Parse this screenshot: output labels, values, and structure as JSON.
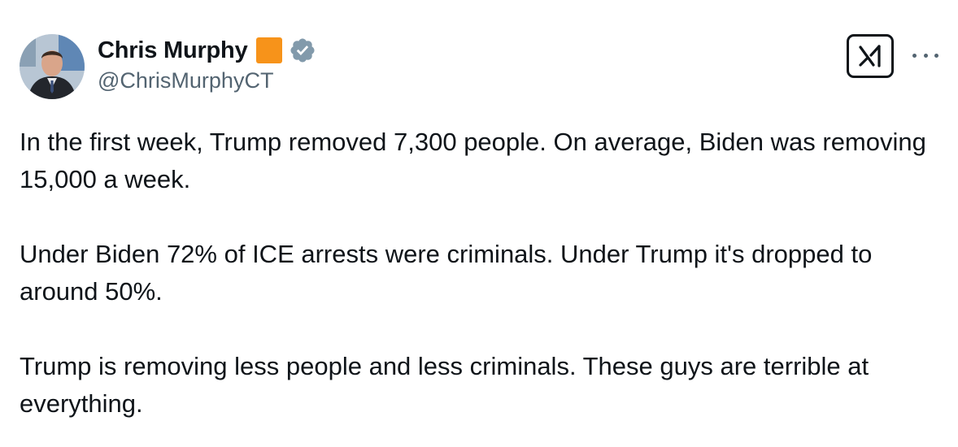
{
  "author": {
    "display_name": "Chris Murphy",
    "handle": "@ChrisMurphyCT",
    "flair_color": "#f7931a",
    "verified_icon": "verified-badge-icon",
    "verified_color": "#829aab"
  },
  "actions": {
    "grok_icon": "grok-icon",
    "more_icon": "more-options-icon"
  },
  "tweet": {
    "paragraphs": [
      "In the first week, Trump removed 7,300 people. On average, Biden was removing 15,000 a week.",
      "Under Biden 72% of ICE arrests were criminals. Under Trump it's dropped to around 50%.",
      "Trump is removing less people and less criminals. These guys are terrible at everything."
    ]
  }
}
